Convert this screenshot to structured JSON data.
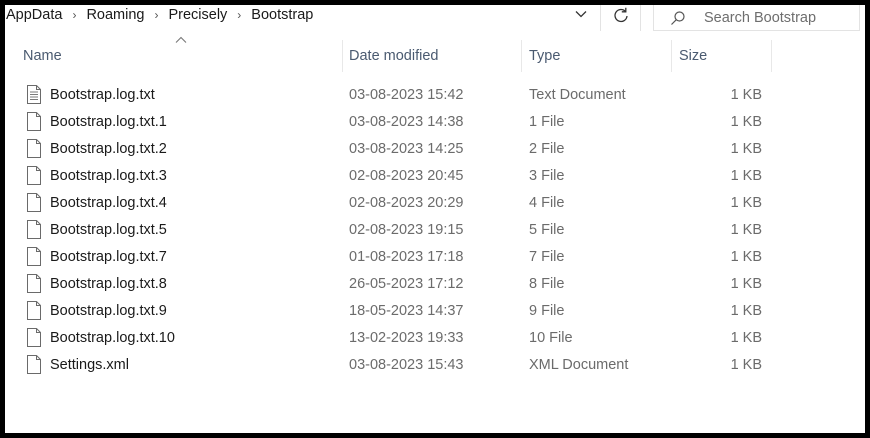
{
  "breadcrumb": [
    "AppData",
    "Roaming",
    "Precisely",
    "Bootstrap"
  ],
  "search": {
    "placeholder": "Search Bootstrap"
  },
  "columns": {
    "name": "Name",
    "date": "Date modified",
    "type": "Type",
    "size": "Size"
  },
  "files": [
    {
      "name": "Bootstrap.log.txt",
      "date": "03-08-2023 15:42",
      "type": "Text Document",
      "size": "1 KB",
      "icon": "text-document-icon"
    },
    {
      "name": "Bootstrap.log.txt.1",
      "date": "03-08-2023 14:38",
      "type": "1 File",
      "size": "1 KB",
      "icon": "file-icon"
    },
    {
      "name": "Bootstrap.log.txt.2",
      "date": "03-08-2023 14:25",
      "type": "2 File",
      "size": "1 KB",
      "icon": "file-icon"
    },
    {
      "name": "Bootstrap.log.txt.3",
      "date": "02-08-2023 20:45",
      "type": "3 File",
      "size": "1 KB",
      "icon": "file-icon"
    },
    {
      "name": "Bootstrap.log.txt.4",
      "date": "02-08-2023 20:29",
      "type": "4 File",
      "size": "1 KB",
      "icon": "file-icon"
    },
    {
      "name": "Bootstrap.log.txt.5",
      "date": "02-08-2023 19:15",
      "type": "5 File",
      "size": "1 KB",
      "icon": "file-icon"
    },
    {
      "name": "Bootstrap.log.txt.7",
      "date": "01-08-2023 17:18",
      "type": "7 File",
      "size": "1 KB",
      "icon": "file-icon"
    },
    {
      "name": "Bootstrap.log.txt.8",
      "date": "26-05-2023 17:12",
      "type": "8 File",
      "size": "1 KB",
      "icon": "file-icon"
    },
    {
      "name": "Bootstrap.log.txt.9",
      "date": "18-05-2023 14:37",
      "type": "9 File",
      "size": "1 KB",
      "icon": "file-icon"
    },
    {
      "name": "Bootstrap.log.txt.10",
      "date": "13-02-2023 19:33",
      "type": "10 File",
      "size": "1 KB",
      "icon": "file-icon"
    },
    {
      "name": "Settings.xml",
      "date": "03-08-2023 15:43",
      "type": "XML Document",
      "size": "1 KB",
      "icon": "file-icon"
    }
  ]
}
